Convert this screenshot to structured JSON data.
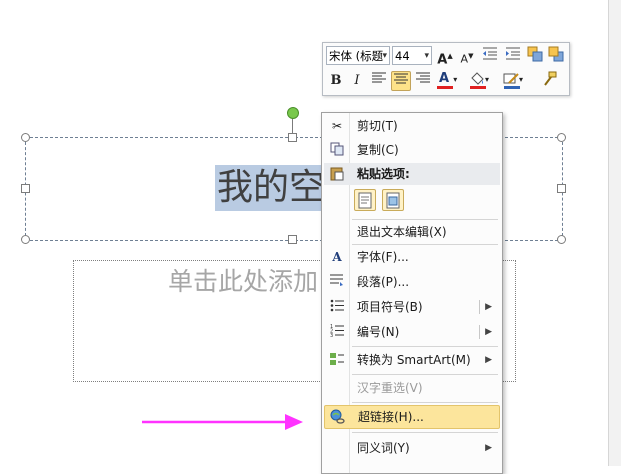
{
  "slide": {
    "title_text": "我的空",
    "subtitle_placeholder": "单击此处添加"
  },
  "mini_toolbar": {
    "font_name": "宋体 (标题",
    "font_size": "44",
    "buttons": {
      "grow_font": "A",
      "shrink_font": "A",
      "bold": "B",
      "italic": "I",
      "font_color": "A"
    }
  },
  "context_menu": {
    "items": [
      {
        "label": "剪切(T)",
        "icon": "scissors-icon"
      },
      {
        "label": "复制(C)",
        "icon": "copy-icon"
      },
      {
        "label": "粘贴选项:",
        "icon": "paste-icon"
      },
      {
        "label": "退出文本编辑(X)"
      },
      {
        "label": "字体(F)...",
        "icon": "font-icon"
      },
      {
        "label": "段落(P)...",
        "icon": "paragraph-icon"
      },
      {
        "label": "项目符号(B)",
        "icon": "bullets-icon"
      },
      {
        "label": "编号(N)",
        "icon": "numbering-icon"
      },
      {
        "label": "转换为 SmartArt(M)",
        "icon": "smartart-icon"
      },
      {
        "label": "汉字重选(V)",
        "disabled": true
      },
      {
        "label": "超链接(H)...",
        "icon": "hyperlink-icon",
        "highlighted": true
      },
      {
        "label": "同义词(Y)"
      }
    ]
  },
  "colors": {
    "highlight": "#fce59c",
    "arrow": "#ff33ff",
    "selection": "#b9cbe2"
  }
}
